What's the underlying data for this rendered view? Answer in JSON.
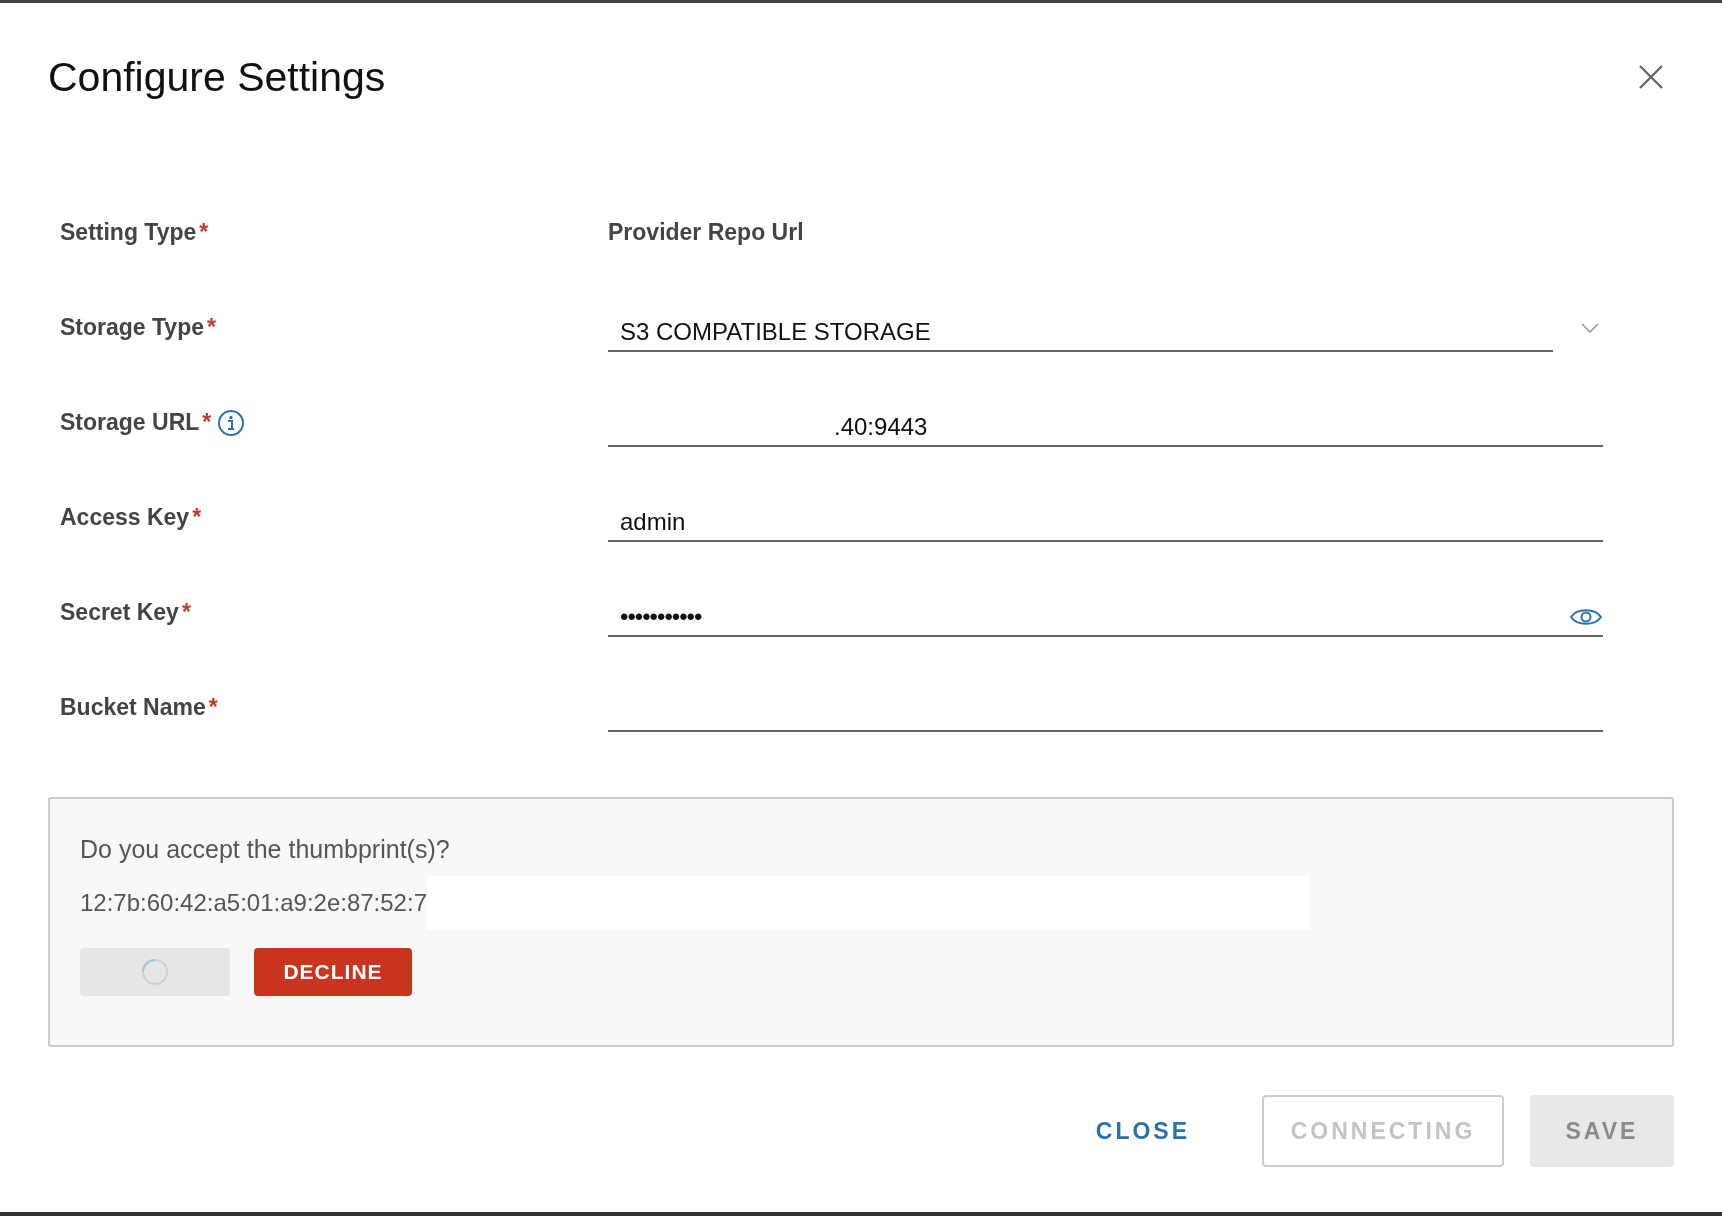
{
  "dialog": {
    "title": "Configure Settings"
  },
  "fields": [
    {
      "label": "Setting Type",
      "required_mark": "*",
      "kind": "static",
      "value": "Provider Repo Url"
    },
    {
      "label": "Storage Type",
      "required_mark": "*",
      "kind": "select",
      "value": "S3 COMPATIBLE STORAGE"
    },
    {
      "label": "Storage URL",
      "required_mark": "*",
      "info": true,
      "kind": "redacted-text",
      "value": ".40:9443"
    },
    {
      "label": "Access Key",
      "required_mark": "*",
      "kind": "text",
      "value": "admin"
    },
    {
      "label": "Secret Key",
      "required_mark": "*",
      "kind": "password",
      "value": "•••••••••••"
    },
    {
      "label": "Bucket Name",
      "required_mark": "*",
      "kind": "text"
    }
  ],
  "thumbprint": {
    "question": "Do you accept the thumbprint(s)?",
    "value": "12:7b:60:42:a5:01:a9:2e:87:52:7",
    "buttons": [
      {
        "kind": "loading"
      },
      {
        "kind": "danger",
        "label": "DECLINE",
        "disabled": false
      }
    ]
  },
  "footer": [
    {
      "kind": "link",
      "label": "CLOSE",
      "disabled": false
    },
    {
      "kind": "outline",
      "label": "CONNECTING",
      "disabled": true
    },
    {
      "kind": "primary",
      "label": "SAVE",
      "disabled": true
    }
  ]
}
